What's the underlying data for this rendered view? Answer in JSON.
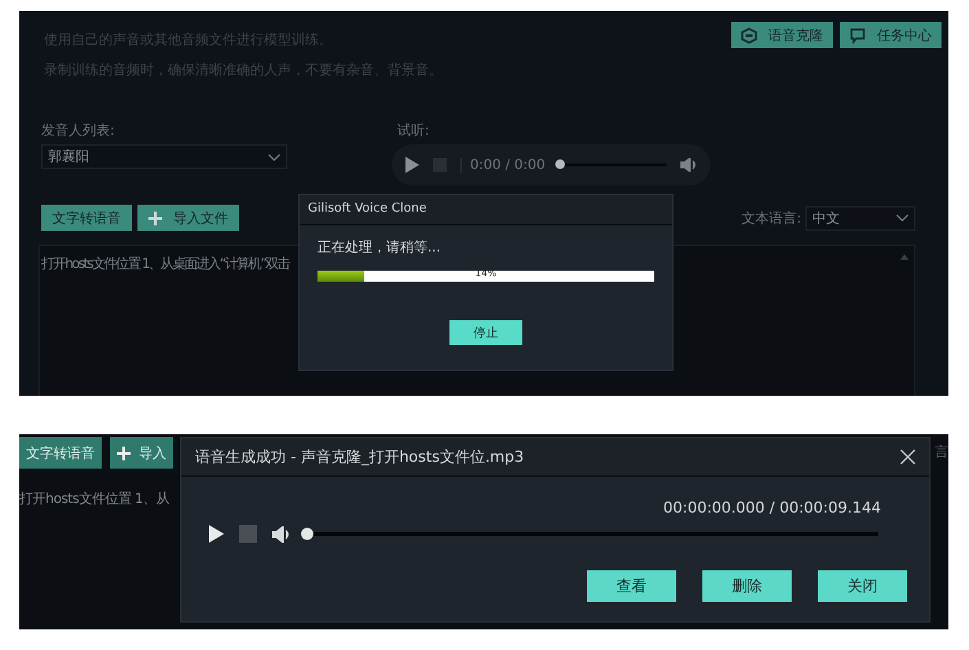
{
  "top": {
    "header_buttons": [
      {
        "label": "语音克隆",
        "kind": "clone"
      },
      {
        "label": "任务中心",
        "kind": "chat"
      }
    ],
    "description": [
      "使用自己的声音或其他音频文件进行模型训练。",
      "录制训练的音频时，确保清晰准确的人声，不要有杂音、背景音。"
    ],
    "speaker": {
      "label": "发音人列表:",
      "value": "郭襄阳"
    },
    "preview": {
      "label": "试听:",
      "time": "0:00 / 0:00",
      "level": 0
    },
    "actions": [
      {
        "label": "文字转语音",
        "kind": "text"
      },
      {
        "label": "导入文件",
        "kind": "add"
      }
    ],
    "language": {
      "label": "文本语言:",
      "value": "中文"
    },
    "text": "打开hosts文件位置 1、从桌面进入“计算机”双击",
    "dialog": {
      "title": "Gilisoft Voice Clone",
      "message": "正在处理，请稍等...",
      "progress": {
        "level": 0.14,
        "label": "14%"
      },
      "button": "停止"
    }
  },
  "bottom": {
    "actions": [
      {
        "label": "文字转语音",
        "kind": "text"
      },
      {
        "label": "导入",
        "kind": "add"
      }
    ],
    "text": "打开hosts文件位置 1、从",
    "language_label": "言",
    "dialog": {
      "title": "语音生成成功 - 声音克隆_打开hosts文件位.mp3",
      "time": "00:00:00.000 / 00:00:09.144",
      "level": 0,
      "buttons": [
        "查看",
        "删除",
        "关闭"
      ]
    }
  }
}
